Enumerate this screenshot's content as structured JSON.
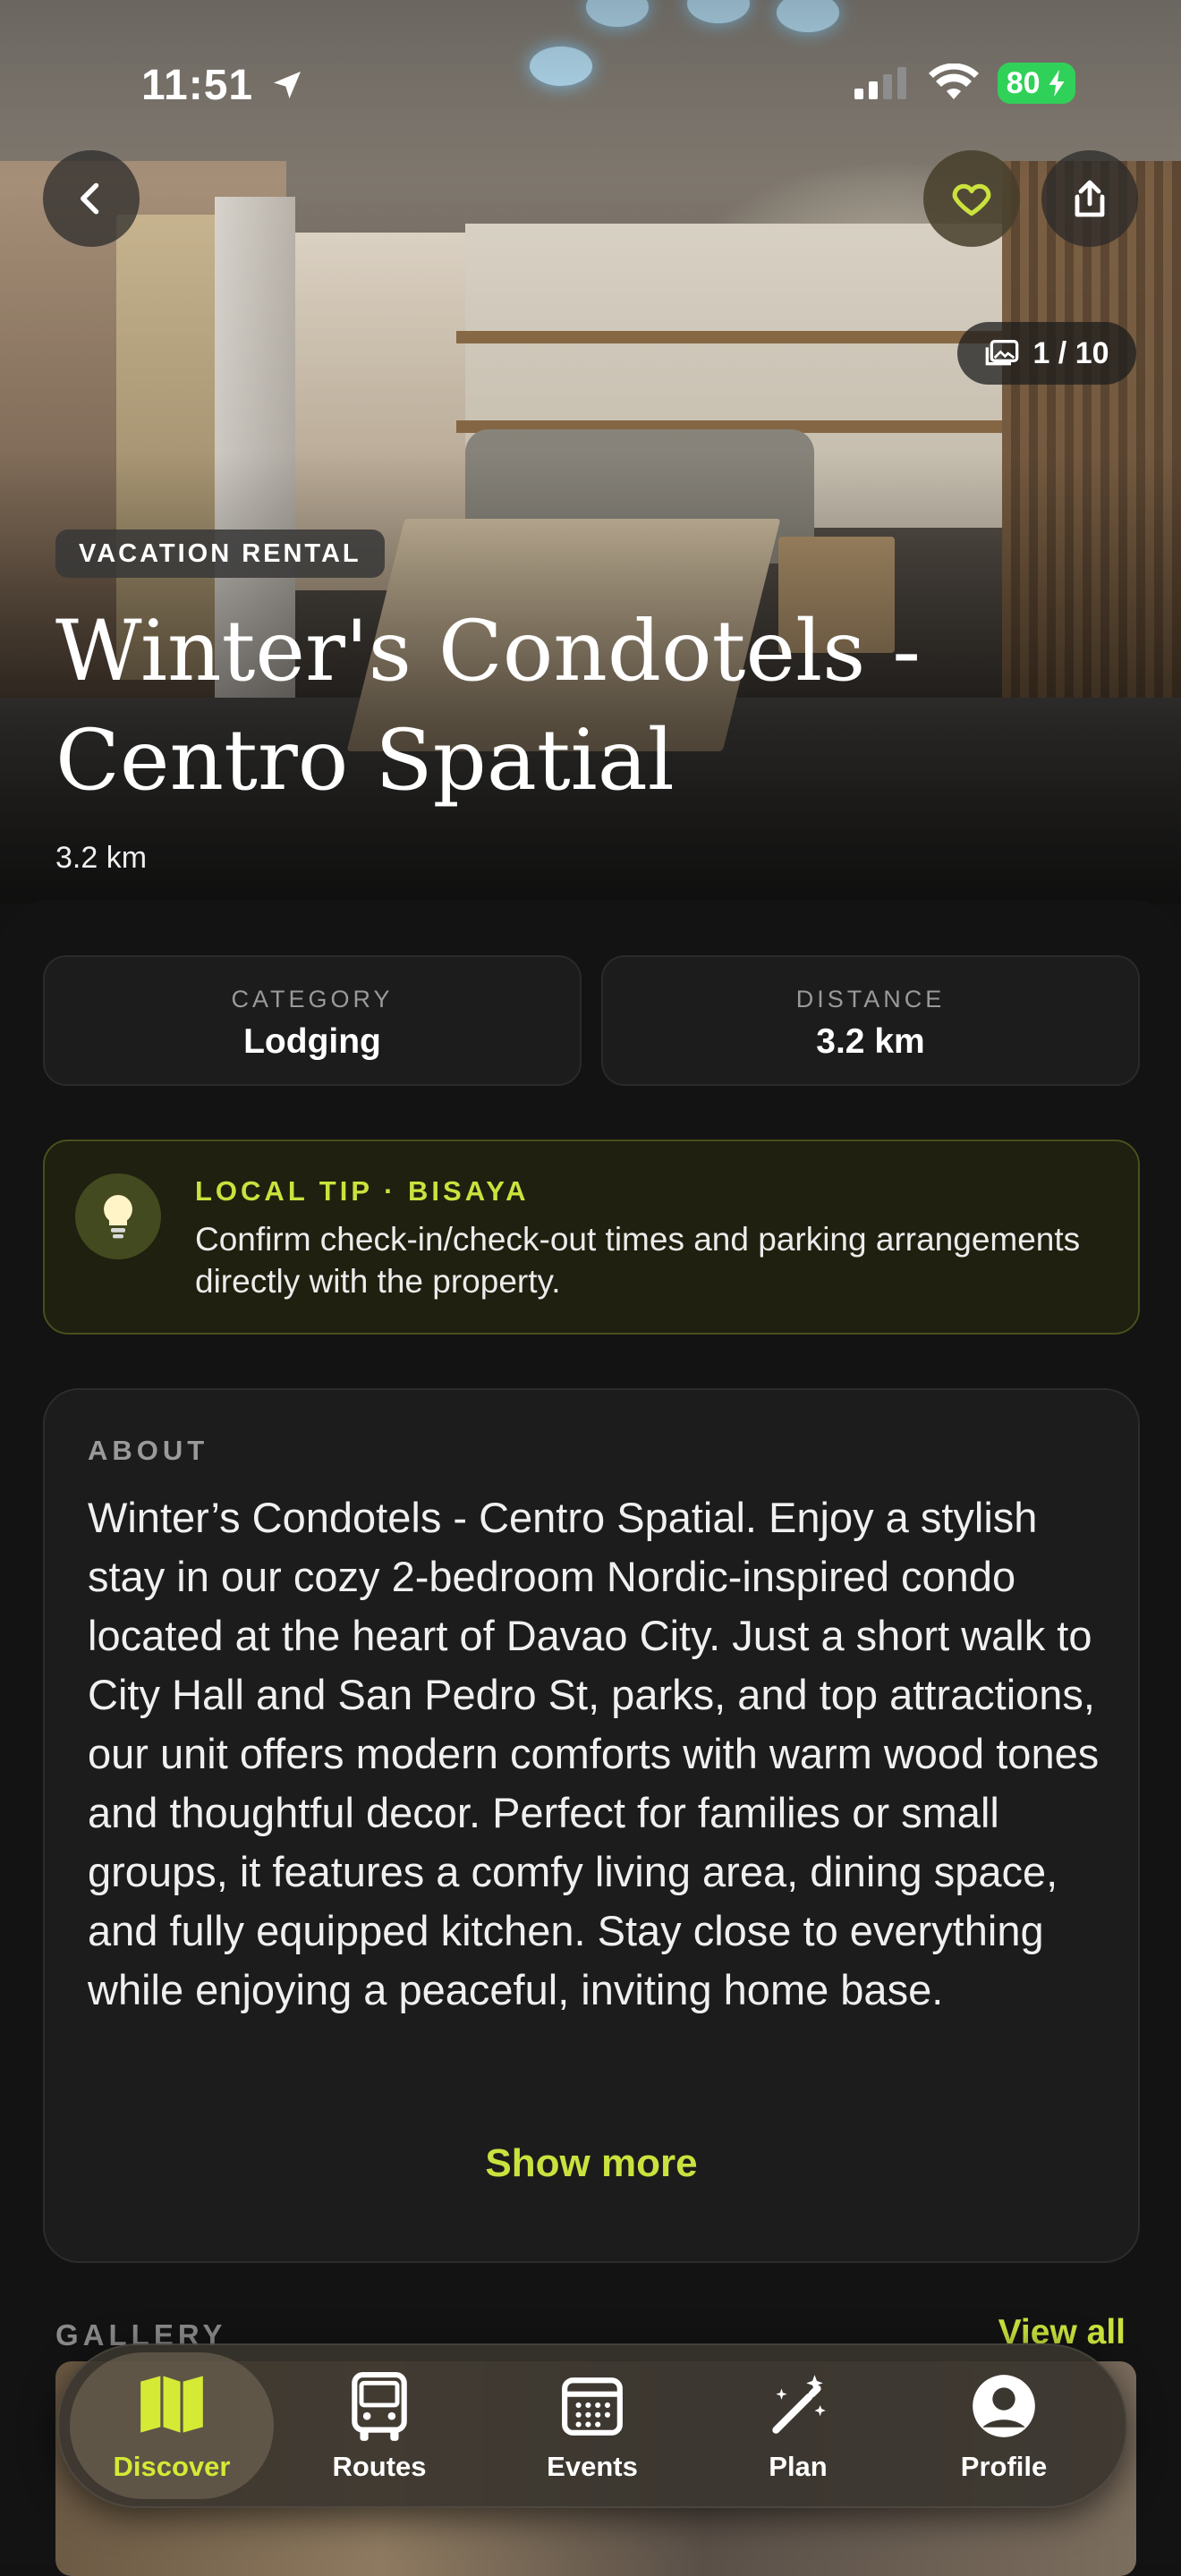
{
  "status_bar": {
    "time": "11:51",
    "battery": "80"
  },
  "hero": {
    "photo_counter": "1 / 10",
    "type_badge": "VACATION RENTAL",
    "title": "Winter's Condotels - Centro Spatial",
    "distance": "3.2 km"
  },
  "stats": [
    {
      "label": "CATEGORY",
      "value": "Lodging"
    },
    {
      "label": "DISTANCE",
      "value": "3.2 km"
    }
  ],
  "tip": {
    "title": "LOCAL TIP · BISAYA",
    "body": "Confirm check-in/check-out times and parking arrangements directly with the property."
  },
  "about": {
    "label": "ABOUT",
    "text": "Winter’s Condotels - Centro Spatial. Enjoy a stylish stay in our cozy 2-bedroom Nordic-inspired condo located at the heart of Davao City. Just a short walk to City Hall and San Pedro St, parks, and top attractions, our unit offers modern comforts with warm wood tones and thoughtful decor. Perfect for families or small groups, it features a comfy living area, dining space, and fully equipped kitchen. Stay close to everything while enjoying a peaceful, inviting home base.",
    "show_more": "Show more"
  },
  "gallery": {
    "label": "GALLERY",
    "view_all": "View all"
  },
  "tabs": [
    {
      "label": "Discover",
      "icon": "map-icon",
      "active": true
    },
    {
      "label": "Routes",
      "icon": "bus-icon",
      "active": false
    },
    {
      "label": "Events",
      "icon": "calendar-icon",
      "active": false
    },
    {
      "label": "Plan",
      "icon": "magic-wand-icon",
      "active": false
    },
    {
      "label": "Profile",
      "icon": "profile-icon",
      "active": false
    }
  ],
  "colors": {
    "accent": "#cbe23e",
    "favorite": "#cbe23e",
    "background": "#131313"
  }
}
